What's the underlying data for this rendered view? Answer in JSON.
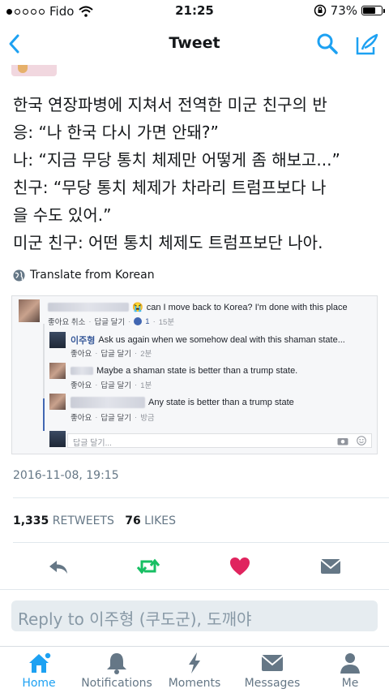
{
  "status_bar": {
    "carrier": "Fido",
    "time": "21:25",
    "battery": "73%",
    "battery_level": 0.73
  },
  "nav": {
    "title": "Tweet",
    "back_icon": "chevron-left-icon",
    "search_icon": "search-icon",
    "compose_icon": "compose-icon"
  },
  "tweet": {
    "lines": [
      "한국 연장파병에 지쳐서 전역한 미군 친구의 반",
      "응: “나 한국 다시 가면 안돼?”",
      "나: “지금 무당 통치 체제만 어떻게 좀 해보고...”",
      "친구: “무당 통치 체제가 차라리 트럼프보다 나",
      "을 수도 있어.”",
      "미군 친구: 어떤 통치 체제도 트럼프보단 나아."
    ],
    "translate": "Translate from Korean",
    "timestamp": "2016-11-08, 19:15",
    "retweets_count": "1,335",
    "retweets_label": "RETWEETS",
    "likes_count": "76",
    "likes_label": "LIKES"
  },
  "embedded": {
    "post_text": "can I move back to Korea? I'm done with this place",
    "post_meta": [
      "좋아요 취소",
      "답글 달기",
      "1",
      "15분"
    ],
    "replies": [
      {
        "name": "이주형",
        "text": "Ask us again when we somehow deal with this shaman state...",
        "meta": [
          "좋아요",
          "답글 달기",
          "2분"
        ]
      },
      {
        "name": "",
        "text": "Maybe a shaman state is better than a trump state.",
        "meta": [
          "좋아요",
          "답글 달기",
          "1분"
        ]
      },
      {
        "name": "",
        "text": "Any state is better than a trump state",
        "meta": [
          "좋아요",
          "답글 달기",
          "방금"
        ]
      }
    ],
    "reply_placeholder": "답글 달기..."
  },
  "actions": {
    "reply_icon": "reply-icon",
    "retweet_icon": "retweet-icon",
    "like_icon": "heart-icon",
    "dm_icon": "envelope-icon",
    "retweet_color": "#17bf63",
    "like_color": "#e0245e"
  },
  "reply_bar": {
    "placeholder": "Reply to 이주형 (쿠도군), 도깨야"
  },
  "tabs": [
    {
      "label": "Home",
      "icon": "home-icon",
      "active": true
    },
    {
      "label": "Notifications",
      "icon": "bell-icon",
      "active": false
    },
    {
      "label": "Moments",
      "icon": "lightning-icon",
      "active": false
    },
    {
      "label": "Messages",
      "icon": "envelope-icon",
      "active": false
    },
    {
      "label": "Me",
      "icon": "person-icon",
      "active": false
    }
  ],
  "colors": {
    "accent": "#1da1f2",
    "muted": "#657786",
    "fb_link": "#365899"
  }
}
